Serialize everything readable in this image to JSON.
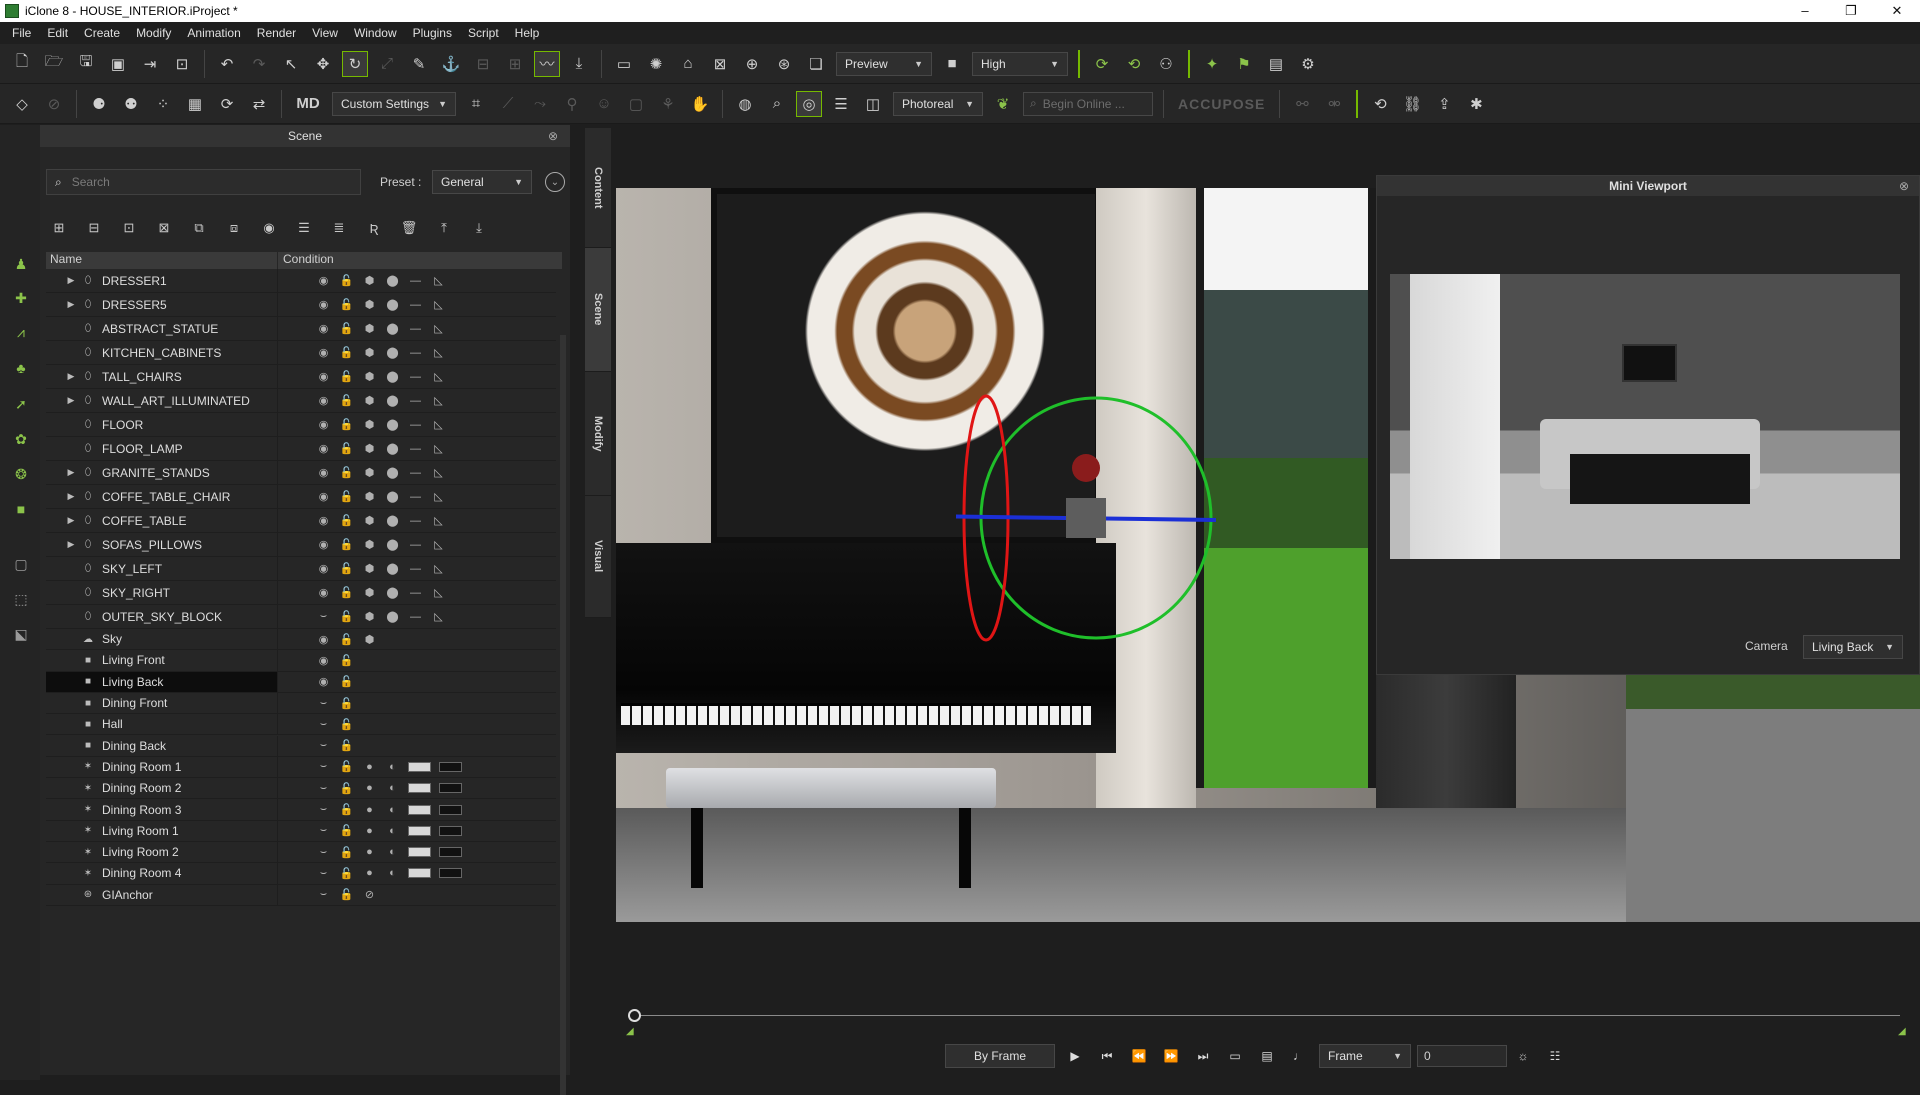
{
  "window": {
    "title": "iClone 8 - HOUSE_INTERIOR.iProject *",
    "minimize": "–",
    "restore": "❐",
    "close": "✕"
  },
  "menu": [
    "File",
    "Edit",
    "Create",
    "Modify",
    "Animation",
    "Render",
    "View",
    "Window",
    "Plugins",
    "Script",
    "Help"
  ],
  "toolbar1": {
    "preview_dropdown": "Preview",
    "quality_dropdown": "High"
  },
  "toolbar2": {
    "custom_settings_dropdown": "Custom Settings",
    "render_mode_dropdown": "Photoreal",
    "search_placeholder": "Begin Online ...",
    "accupose_label": "ACCUPOSE"
  },
  "scene_panel": {
    "title": "Scene",
    "search_placeholder": "Search",
    "preset_label": "Preset :",
    "preset_value": "General",
    "col_name": "Name",
    "col_condition": "Condition",
    "rows": [
      {
        "label": "DRESSER1",
        "type": "prop",
        "expandable": true
      },
      {
        "label": "DRESSER5",
        "type": "prop",
        "expandable": true
      },
      {
        "label": "ABSTRACT_STATUE",
        "type": "prop",
        "expandable": false
      },
      {
        "label": "KITCHEN_CABINETS",
        "type": "prop",
        "expandable": false
      },
      {
        "label": "TALL_CHAIRS",
        "type": "prop",
        "expandable": true
      },
      {
        "label": "WALL_ART_ILLUMINATED",
        "type": "prop",
        "expandable": true
      },
      {
        "label": "FLOOR",
        "type": "prop",
        "expandable": false
      },
      {
        "label": "FLOOR_LAMP",
        "type": "prop",
        "expandable": false
      },
      {
        "label": "GRANITE_STANDS",
        "type": "prop",
        "expandable": true
      },
      {
        "label": "COFFE_TABLE_CHAIR",
        "type": "prop",
        "expandable": true
      },
      {
        "label": "COFFE_TABLE",
        "type": "prop",
        "expandable": true
      },
      {
        "label": "SOFAS_PILLOWS",
        "type": "prop",
        "expandable": true
      },
      {
        "label": "SKY_LEFT",
        "type": "prop",
        "expandable": false
      },
      {
        "label": "SKY_RIGHT",
        "type": "prop",
        "expandable": false
      },
      {
        "label": "OUTER_SKY_BLOCK",
        "type": "prop-hidden",
        "expandable": false
      },
      {
        "label": "Sky",
        "type": "sky",
        "expandable": false
      },
      {
        "label": "Living Front",
        "type": "camera",
        "expandable": false
      },
      {
        "label": "Living Back",
        "type": "camera",
        "expandable": false,
        "selected": true
      },
      {
        "label": "Dining Front",
        "type": "camera-hidden",
        "expandable": false
      },
      {
        "label": "Hall",
        "type": "camera-hidden",
        "expandable": false
      },
      {
        "label": "Dining Back",
        "type": "camera-hidden",
        "expandable": false
      },
      {
        "label": "Dining Room 1",
        "type": "light",
        "expandable": false
      },
      {
        "label": "Dining Room 2",
        "type": "light",
        "expandable": false
      },
      {
        "label": "Dining Room 3",
        "type": "light",
        "expandable": false
      },
      {
        "label": "Living Room 1",
        "type": "light",
        "expandable": false
      },
      {
        "label": "Living Room 2",
        "type": "light",
        "expandable": false
      },
      {
        "label": "Dining Room 4",
        "type": "light",
        "expandable": false
      },
      {
        "label": "GIAnchor",
        "type": "anchor",
        "expandable": false
      }
    ]
  },
  "side_tabs": [
    "Content",
    "Scene",
    "Modify",
    "Visual"
  ],
  "mini_viewport": {
    "title": "Mini Viewport",
    "camera_label": "Camera",
    "camera_value": "Living Back"
  },
  "timeline": {
    "mode_dropdown": "By Frame",
    "unit_dropdown": "Frame",
    "frame_value": "0"
  },
  "colors": {
    "accent": "#76b900",
    "selection": "#0d0d0d"
  }
}
